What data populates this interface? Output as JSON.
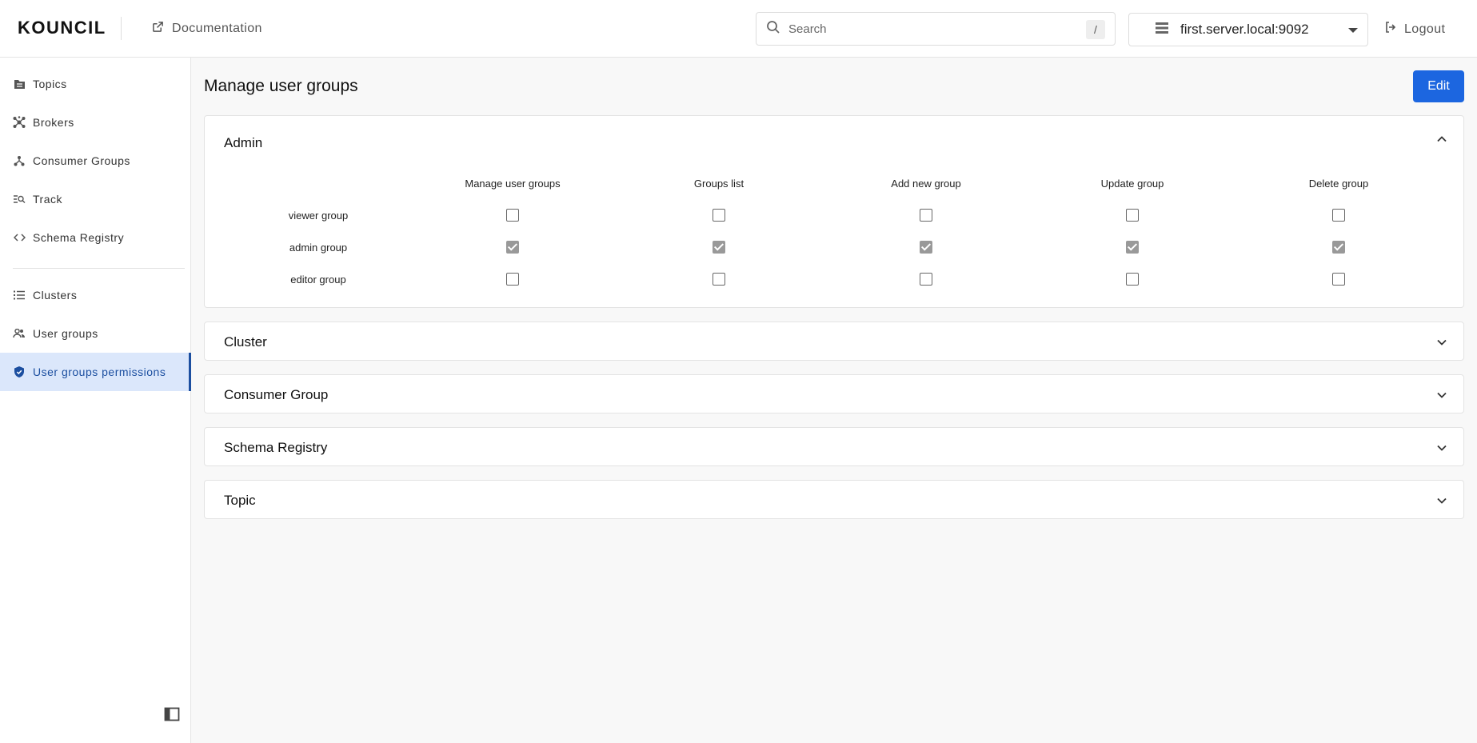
{
  "header": {
    "logo": "KOUNCIL",
    "doc_label": "Documentation",
    "search_placeholder": "Search",
    "search_shortcut": "/",
    "server": "first.server.local:9092",
    "logout_label": "Logout"
  },
  "sidebar": {
    "items": [
      {
        "label": "Topics",
        "icon": "folder-icon"
      },
      {
        "label": "Brokers",
        "icon": "hub-icon"
      },
      {
        "label": "Consumer Groups",
        "icon": "tree-icon"
      },
      {
        "label": "Track",
        "icon": "track-search-icon"
      },
      {
        "label": "Schema Registry",
        "icon": "code-icon"
      },
      {
        "label": "Clusters",
        "icon": "list-icon"
      },
      {
        "label": "User groups",
        "icon": "users-icon"
      },
      {
        "label": "User groups permissions",
        "icon": "shield-icon",
        "active": true
      }
    ]
  },
  "main": {
    "title": "Manage user groups",
    "edit_label": "Edit",
    "panels": [
      {
        "title": "Admin",
        "expanded": true,
        "columns": [
          "Manage user groups",
          "Groups list",
          "Add new group",
          "Update group",
          "Delete group"
        ],
        "rows": [
          {
            "label": "viewer group",
            "checks": [
              false,
              false,
              false,
              false,
              false
            ]
          },
          {
            "label": "admin group",
            "checks": [
              true,
              true,
              true,
              true,
              true
            ]
          },
          {
            "label": "editor group",
            "checks": [
              false,
              false,
              false,
              false,
              false
            ]
          }
        ]
      },
      {
        "title": "Cluster",
        "expanded": false
      },
      {
        "title": "Consumer Group",
        "expanded": false
      },
      {
        "title": "Schema Registry",
        "expanded": false
      },
      {
        "title": "Topic",
        "expanded": false
      }
    ]
  },
  "colors": {
    "primary": "#1c66e0",
    "active_nav_bg": "#dbe7fb",
    "active_nav_text": "#1c4fa0"
  }
}
